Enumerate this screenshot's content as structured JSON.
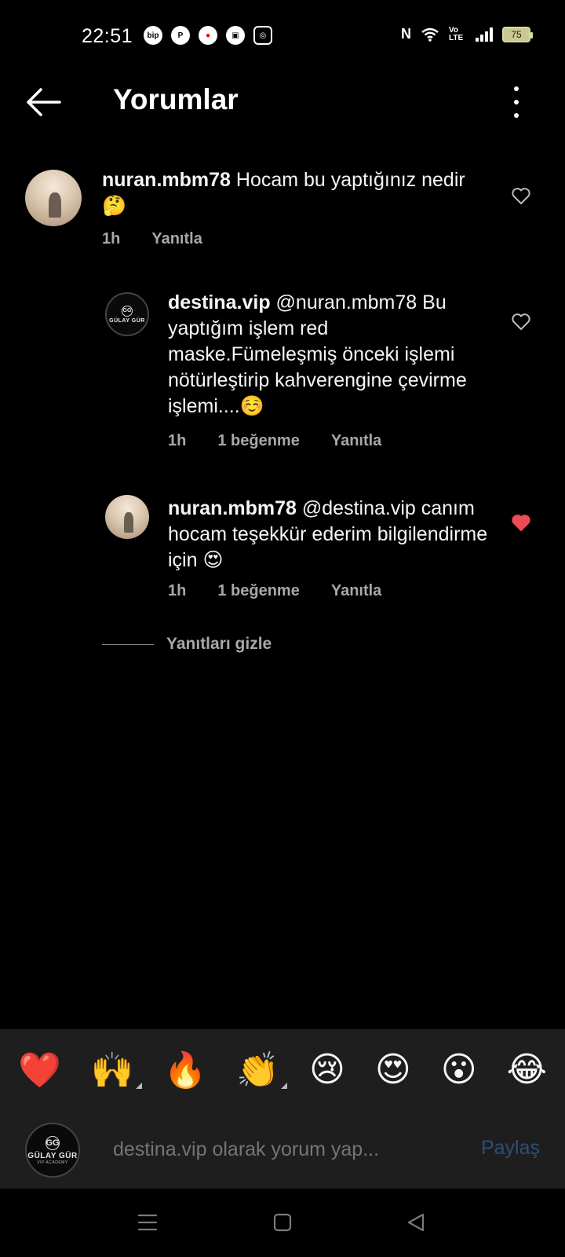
{
  "status_bar": {
    "time": "22:51",
    "app_icons": [
      "bip",
      "pinterest",
      "vodafone",
      "box",
      "instagram"
    ],
    "battery": "75",
    "network": "Vo LTE"
  },
  "header": {
    "title": "Yorumlar"
  },
  "comments": [
    {
      "username": "nuran.mbm78",
      "text": "Hocam bu yaptığınız nedir 🤔",
      "time": "1h",
      "reply_label": "Yanıtla",
      "liked": false
    },
    {
      "username": "destina.vip",
      "mention": "@nuran.mbm78",
      "text": "Bu yaptığım işlem red maske.Fümeleşmiş önceki işlemi nötürleştirip kahverengine çevirme işlemi....☺️",
      "time": "1h",
      "likes": "1 beğenme",
      "reply_label": "Yanıtla",
      "liked": false
    },
    {
      "username": "nuran.mbm78",
      "mention": "@destina.vip",
      "text": "canım hocam teşekkür ederim bilgilendirme için 😍",
      "time": "1h",
      "likes": "1 beğenme",
      "reply_label": "Yanıtla",
      "liked": true
    }
  ],
  "hide_replies": "Yanıtları gizle",
  "emojis": [
    "❤️",
    "🙌",
    "🔥",
    "👏",
    "😢",
    "😍",
    "😮",
    "😂"
  ],
  "composer": {
    "placeholder": "destina.vip olarak yorum yap...",
    "share_label": "Paylaş"
  },
  "logo": {
    "mark": "GG",
    "name": "GÜLAY GÜR",
    "sub": "VIP ACADEMY"
  },
  "colors": {
    "background": "#000000",
    "panel": "#1e1e1e",
    "muted_text": "#a8a8a8",
    "like_red": "#ed4956",
    "share_blue": "#2d4f78"
  }
}
